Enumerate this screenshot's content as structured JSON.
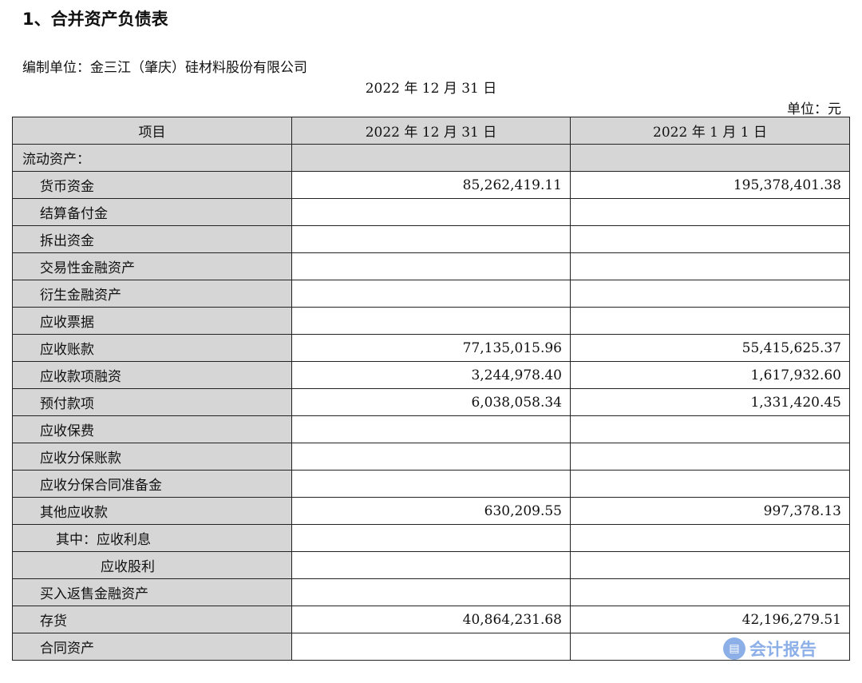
{
  "section_heading": "1、合并资产负债表",
  "compiling_unit": "编制单位：金三江（肇庆）硅材料股份有限公司",
  "report_date": "2022 年 12 月 31 日",
  "currency_unit": "单位：元",
  "table": {
    "headers": [
      "项目",
      "2022 年 12 月 31 日",
      "2022 年 1 月 1 日"
    ],
    "rows": [
      {
        "item": "流动资产：",
        "current": "",
        "previous": "",
        "section": true,
        "indent": 0
      },
      {
        "item": "货币资金",
        "current": "85,262,419.11",
        "previous": "195,378,401.38",
        "indent": 1
      },
      {
        "item": "结算备付金",
        "current": "",
        "previous": "",
        "indent": 1
      },
      {
        "item": "拆出资金",
        "current": "",
        "previous": "",
        "indent": 1
      },
      {
        "item": "交易性金融资产",
        "current": "",
        "previous": "",
        "indent": 1
      },
      {
        "item": "衍生金融资产",
        "current": "",
        "previous": "",
        "indent": 1
      },
      {
        "item": "应收票据",
        "current": "",
        "previous": "",
        "indent": 1
      },
      {
        "item": "应收账款",
        "current": "77,135,015.96",
        "previous": "55,415,625.37",
        "indent": 1
      },
      {
        "item": "应收款项融资",
        "current": "3,244,978.40",
        "previous": "1,617,932.60",
        "indent": 1
      },
      {
        "item": "预付款项",
        "current": "6,038,058.34",
        "previous": "1,331,420.45",
        "indent": 1
      },
      {
        "item": "应收保费",
        "current": "",
        "previous": "",
        "indent": 1
      },
      {
        "item": "应收分保账款",
        "current": "",
        "previous": "",
        "indent": 1
      },
      {
        "item": "应收分保合同准备金",
        "current": "",
        "previous": "",
        "indent": 1
      },
      {
        "item": "其他应收款",
        "current": "630,209.55",
        "previous": "997,378.13",
        "indent": 1
      },
      {
        "item": "其中：应收利息",
        "current": "",
        "previous": "",
        "indent": 2
      },
      {
        "item": "应收股利",
        "current": "",
        "previous": "",
        "indent": 3
      },
      {
        "item": "买入返售金融资产",
        "current": "",
        "previous": "",
        "indent": 1
      },
      {
        "item": "存货",
        "current": "40,864,231.68",
        "previous": "42,196,279.51",
        "indent": 1
      },
      {
        "item": "合同资产",
        "current": "",
        "previous": "",
        "indent": 1
      }
    ]
  },
  "watermark": {
    "icon": "document-icon",
    "text": "会计报告",
    "color": "#2f6fd6"
  }
}
